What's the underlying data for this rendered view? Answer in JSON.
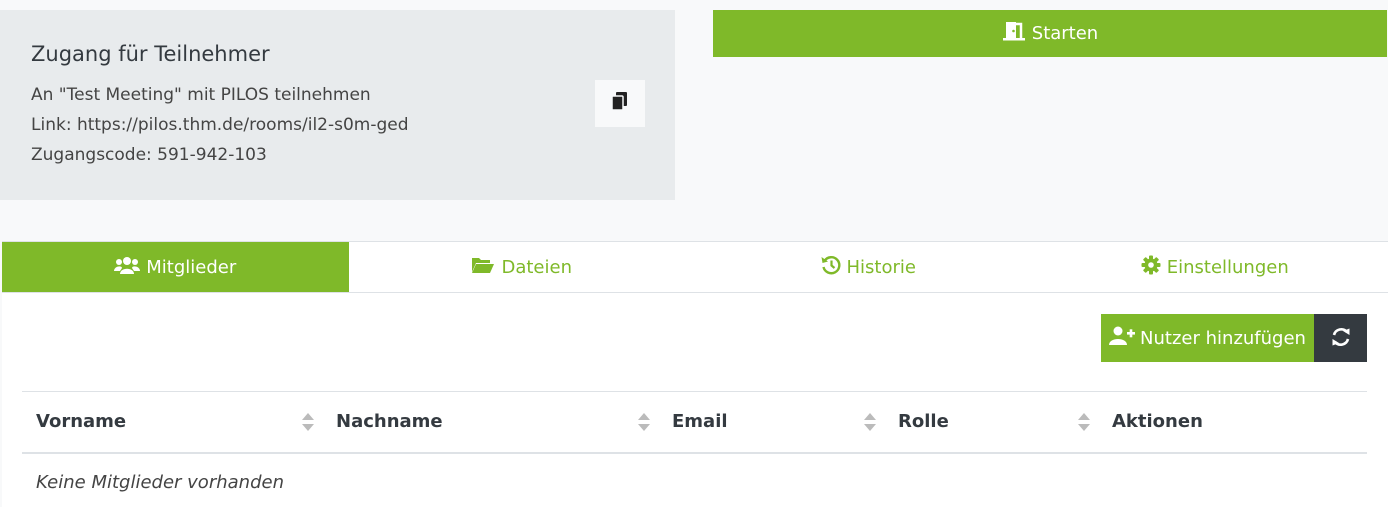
{
  "access": {
    "title": "Zugang für Teilnehmer",
    "invite_line": "An \"Test Meeting\" mit PILOS teilnehmen",
    "link_line": "Link: https://pilos.thm.de/rooms/il2-s0m-ged",
    "code_line": "Zugangscode: 591-942-103",
    "copy_icon": "copy-icon"
  },
  "start": {
    "label": "Starten",
    "icon": "door-open-icon"
  },
  "tabs": [
    {
      "label": "Mitglieder",
      "icon": "users-icon",
      "active": true
    },
    {
      "label": "Dateien",
      "icon": "folder-open-icon",
      "active": false
    },
    {
      "label": "Historie",
      "icon": "history-icon",
      "active": false
    },
    {
      "label": "Einstellungen",
      "icon": "gear-icon",
      "active": false
    }
  ],
  "toolbar": {
    "add_label": "Nutzer hinzufügen",
    "add_icon": "user-plus-icon",
    "reload_icon": "refresh-icon"
  },
  "table": {
    "columns": [
      "Vorname",
      "Nachname",
      "Email",
      "Rolle",
      "Aktionen"
    ],
    "empty_text": "Keine Mitglieder vorhanden"
  },
  "colors": {
    "accent": "#7fb929",
    "dark": "#343a40",
    "card_bg": "#e8ebed"
  }
}
